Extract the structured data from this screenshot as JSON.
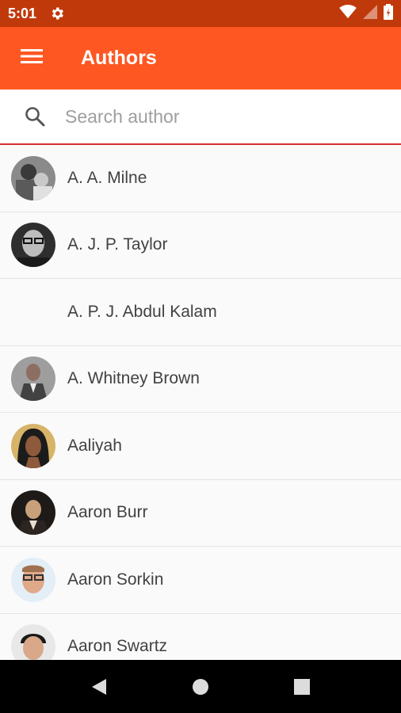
{
  "status_bar": {
    "time": "5:01"
  },
  "app_bar": {
    "title": "Authors"
  },
  "search": {
    "placeholder": "Search author"
  },
  "authors": [
    {
      "name": "A. A. Milne",
      "avatar": "photo-bw-child"
    },
    {
      "name": "A. J. P. Taylor",
      "avatar": "photo-bw-glasses"
    },
    {
      "name": "A. P. J. Abdul Kalam",
      "avatar": "none"
    },
    {
      "name": "A. Whitney Brown",
      "avatar": "photo-man-suit"
    },
    {
      "name": "Aaliyah",
      "avatar": "photo-woman"
    },
    {
      "name": "Aaron Burr",
      "avatar": "photo-portrait"
    },
    {
      "name": "Aaron Sorkin",
      "avatar": "photo-man-glasses"
    },
    {
      "name": "Aaron Swartz",
      "avatar": "photo-young-man"
    }
  ],
  "colors": {
    "status_bar": "#c0390b",
    "app_bar": "#fe5722",
    "search_underline": "#d32f2f",
    "background": "#fafafa"
  }
}
